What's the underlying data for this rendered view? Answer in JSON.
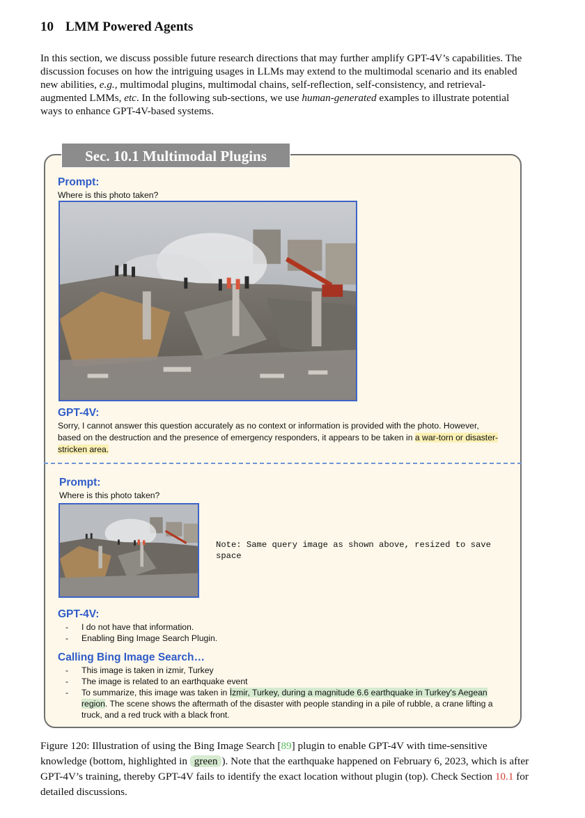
{
  "section": {
    "number": "10",
    "title": "LMM Powered Agents"
  },
  "intro": {
    "part1": "In this section, we discuss possible future research directions that may further amplify GPT-4V’s capabilities. The discussion focuses on how the intriguing usages in LLMs may extend to the multimodal scenario and its enabled new abilities, ",
    "eg": "e.g.",
    "part2": ", multimodal plugins, multimodal chains, self-reflection, self-consistency, and retrieval-augmented LMMs, ",
    "etc": "etc",
    "part3": ". In the following sub-sections, we use ",
    "human": "human-generated",
    "part4": " examples to illustrate potential ways to enhance GPT-4V-based systems."
  },
  "panel": {
    "tab_title": "Sec. 10.1 Multimodal Plugins",
    "top": {
      "prompt_label": "Prompt:",
      "prompt_text": "Where is this photo taken?",
      "response_label": "GPT-4V:",
      "response_plain": "Sorry, I cannot answer this question accurately as no context or information is provided with the photo. However, based on the destruction and the presence of emergency responders, it appears to be taken in ",
      "response_highlight": "a war-torn or disaster-stricken area."
    },
    "bottom": {
      "prompt_label": "Prompt:",
      "prompt_text": "Where is this photo taken?",
      "note": "Note: Same query image as shown above, resized to save space",
      "response_label": "GPT-4V:",
      "response_items": [
        "I do not have that information.",
        "Enabling Bing Image Search Plugin."
      ],
      "bing_label": "Calling Bing Image Search…",
      "bing_item1": "This image is taken in izmir, Turkey",
      "bing_item2": "The image is related to an earthquake event",
      "bing_item3_plain1": "To summarize, this image was taken in ",
      "bing_item3_highlight": "İzmir, Turkey, during a magnitude 6.6 earthquake in Turkey's Aegean region",
      "bing_item3_plain2": ". The scene shows the aftermath of the disaster with people standing in a pile of rubble, a crane lifting a truck, and a red truck with a black front."
    }
  },
  "caption": {
    "part1": "Figure 120: Illustration of using the Bing Image Search [",
    "cite": "89",
    "part2": "] plugin to enable GPT-4V with time-sensitive knowledge (bottom, highlighted in ",
    "green_word": "green",
    "part3": "). Note that the earthquake happened on February 6, 2023, which is after GPT-4V’s training, thereby GPT-4V fails to identify the exact location without plugin (top). Check Section ",
    "secref": "10.1",
    "part4": " for detailed discussions."
  },
  "colors": {
    "prompt_blue": "#2f5bc8",
    "panel_bg": "#fdf8ea",
    "tab_gray": "#8c8c8c",
    "highlight_yellow": "#fbf0b4",
    "highlight_green": "#d6ead0",
    "cite_green": "#59b85a",
    "ref_red": "#d23a2e"
  }
}
